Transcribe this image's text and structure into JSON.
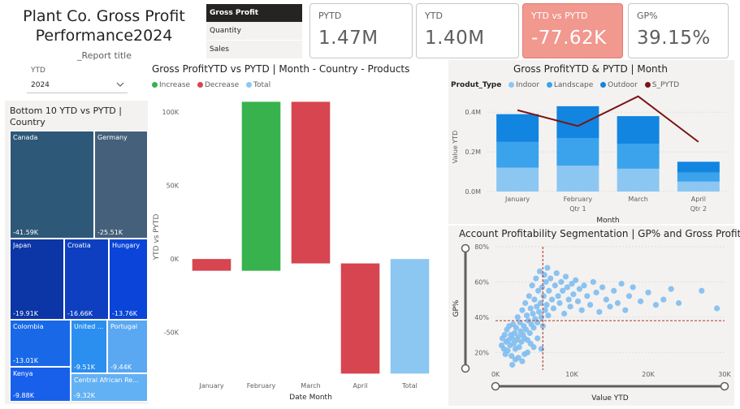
{
  "header": {
    "title_line1": "Plant Co. Gross Profit",
    "title_line2": "Performance2024",
    "report_title": "_Report title"
  },
  "slicer": {
    "label": "YTD",
    "value": "2024"
  },
  "segment_buttons": [
    {
      "label": "Gross Profit",
      "active": true
    },
    {
      "label": "Quantity",
      "active": false
    },
    {
      "label": "Sales",
      "active": false
    }
  ],
  "kpis": [
    {
      "label": "PYTD",
      "value": "1.47M"
    },
    {
      "label": "YTD",
      "value": "1.40M"
    },
    {
      "label": "YTD vs PYTD",
      "value": "-77.62K"
    },
    {
      "label": "GP%",
      "value": "39.15%"
    }
  ],
  "treemap": {
    "title": "Bottom 10 YTD vs PYTD | Country",
    "items": [
      {
        "name": "Canada",
        "value": "-41.59K",
        "color": "#2e5878"
      },
      {
        "name": "Germany",
        "value": "-25.51K",
        "color": "#44607a"
      },
      {
        "name": "Japan",
        "value": "-19.91K",
        "color": "#0c35a6"
      },
      {
        "name": "Croatia",
        "value": "-16.66K",
        "color": "#0d3fc0"
      },
      {
        "name": "Hungary",
        "value": "-13.76K",
        "color": "#0a44d8"
      },
      {
        "name": "Colombia",
        "value": "-13.01K",
        "color": "#1868e8"
      },
      {
        "name": "United ...",
        "value": "-9.51K",
        "color": "#2b8ff0"
      },
      {
        "name": "Portugal",
        "value": "-9.44K",
        "color": "#5aa8f2"
      },
      {
        "name": "Kenya",
        "value": "-9.88K",
        "color": "#1860ea"
      },
      {
        "name": "Central African Re...",
        "value": "-9.32K",
        "color": "#62b1f4"
      }
    ]
  },
  "waterfall": {
    "title": "Gross ProfitYTD vs PYTD | Month - Country - Products",
    "legend": [
      {
        "label": "Increase",
        "color": "#37b24d"
      },
      {
        "label": "Decrease",
        "color": "#d64550"
      },
      {
        "label": "Total",
        "color": "#8cc7f2"
      }
    ],
    "ylabel": "YTD vs PYTD",
    "xlabel": "Date Month"
  },
  "stacked": {
    "title": "Gross ProfitYTD & PYTD | Month",
    "legend_title": "Produt_Type",
    "legend": [
      {
        "label": "Indoor",
        "color": "#8cc7f2"
      },
      {
        "label": "Landscape",
        "color": "#3aa3ec"
      },
      {
        "label": "Outdoor",
        "color": "#1185e0"
      },
      {
        "label": "S_PYTD",
        "color": "#7b1414"
      }
    ],
    "ylabel": "Value YTD",
    "xlabel": "Month"
  },
  "scatter": {
    "title": "Account Profitability Segmentation | GP% and Gross Profit",
    "ylabel": "GP%",
    "xlabel": "Value YTD"
  },
  "chart_data": [
    {
      "type": "bar",
      "subtype": "waterfall",
      "categories": [
        "January",
        "February",
        "March",
        "April",
        "Total"
      ],
      "values": [
        -8000,
        115000,
        -110000,
        -75000,
        -78000
      ],
      "ylim": [
        -80000,
        110000
      ],
      "yticks": [
        "100K",
        "50K",
        "0K",
        "-50K"
      ],
      "ylabel": "YTD vs PYTD",
      "xlabel": "Date Month",
      "grid": false
    },
    {
      "type": "bar",
      "subtype": "stacked+line",
      "categories": [
        "January",
        "February",
        "March",
        "April"
      ],
      "category_groups": [
        "Qtr 1",
        "Qtr 1",
        "Qtr 1",
        "Qtr 2"
      ],
      "series": [
        {
          "name": "Indoor",
          "values": [
            120000,
            130000,
            115000,
            50000
          ]
        },
        {
          "name": "Landscape",
          "values": [
            130000,
            140000,
            125000,
            45000
          ]
        },
        {
          "name": "Outdoor",
          "values": [
            140000,
            160000,
            140000,
            55000
          ]
        }
      ],
      "line": {
        "name": "S_PYTD",
        "values": [
          410000,
          330000,
          480000,
          250000
        ]
      },
      "ylim": [
        0,
        450000
      ],
      "yticks": [
        "0.0M",
        "0.2M",
        "0.4M"
      ],
      "ylabel": "Value YTD",
      "xlabel": "Month"
    },
    {
      "type": "scatter",
      "xlim": [
        0,
        30000
      ],
      "ylim": [
        10,
        80
      ],
      "xticks": [
        "0K",
        "10K",
        "20K",
        "30K"
      ],
      "yticks": [
        "20%",
        "40%",
        "60%",
        "80%"
      ],
      "reference_lines": {
        "x": 6200,
        "y": 38
      },
      "xlabel": "Value YTD",
      "ylabel": "GP%",
      "points": [
        [
          800,
          24
        ],
        [
          900,
          28
        ],
        [
          1100,
          22
        ],
        [
          1200,
          30
        ],
        [
          1300,
          19
        ],
        [
          1400,
          26
        ],
        [
          1500,
          33
        ],
        [
          1600,
          21
        ],
        [
          1700,
          27
        ],
        [
          1800,
          35
        ],
        [
          1900,
          24
        ],
        [
          2000,
          30
        ],
        [
          2100,
          18
        ],
        [
          2200,
          28
        ],
        [
          2300,
          36
        ],
        [
          2400,
          25
        ],
        [
          2500,
          31
        ],
        [
          2600,
          22
        ],
        [
          2700,
          34
        ],
        [
          2800,
          27
        ],
        [
          2900,
          40
        ],
        [
          3000,
          29
        ],
        [
          3100,
          23
        ],
        [
          3200,
          37
        ],
        [
          3300,
          32
        ],
        [
          3400,
          26
        ],
        [
          3500,
          44
        ],
        [
          3600,
          30
        ],
        [
          3700,
          35
        ],
        [
          3800,
          28
        ],
        [
          3900,
          48
        ],
        [
          4000,
          33
        ],
        [
          4100,
          41
        ],
        [
          4200,
          27
        ],
        [
          4300,
          38
        ],
        [
          4400,
          52
        ],
        [
          4500,
          31
        ],
        [
          4600,
          45
        ],
        [
          4700,
          36
        ],
        [
          4800,
          58
        ],
        [
          4900,
          42
        ],
        [
          5000,
          34
        ],
        [
          5100,
          50
        ],
        [
          5200,
          39
        ],
        [
          5300,
          62
        ],
        [
          5400,
          46
        ],
        [
          5500,
          37
        ],
        [
          5600,
          55
        ],
        [
          5700,
          43
        ],
        [
          5800,
          66
        ],
        [
          5900,
          48
        ],
        [
          6000,
          40
        ],
        [
          6100,
          57
        ],
        [
          6200,
          35
        ],
        [
          6300,
          52
        ],
        [
          6400,
          64
        ],
        [
          6500,
          44
        ],
        [
          6600,
          60
        ],
        [
          6700,
          47
        ],
        [
          6800,
          68
        ],
        [
          6900,
          41
        ],
        [
          7000,
          55
        ],
        [
          7200,
          62
        ],
        [
          7400,
          50
        ],
        [
          7600,
          45
        ],
        [
          7800,
          58
        ],
        [
          8000,
          65
        ],
        [
          8200,
          52
        ],
        [
          8400,
          48
        ],
        [
          8600,
          60
        ],
        [
          8800,
          55
        ],
        [
          9000,
          42
        ],
        [
          9200,
          63
        ],
        [
          9400,
          57
        ],
        [
          9600,
          50
        ],
        [
          9800,
          46
        ],
        [
          10000,
          59
        ],
        [
          10200,
          53
        ],
        [
          10500,
          61
        ],
        [
          10800,
          49
        ],
        [
          11000,
          56
        ],
        [
          11300,
          44
        ],
        [
          11600,
          58
        ],
        [
          12000,
          52
        ],
        [
          12400,
          47
        ],
        [
          12800,
          60
        ],
        [
          13200,
          54
        ],
        [
          13600,
          43
        ],
        [
          14000,
          57
        ],
        [
          14500,
          50
        ],
        [
          15000,
          46
        ],
        [
          15500,
          55
        ],
        [
          16000,
          48
        ],
        [
          16500,
          59
        ],
        [
          17000,
          44
        ],
        [
          17500,
          52
        ],
        [
          18000,
          57
        ],
        [
          19000,
          49
        ],
        [
          20000,
          54
        ],
        [
          21000,
          47
        ],
        [
          22000,
          50
        ],
        [
          23000,
          56
        ],
        [
          24000,
          48
        ],
        [
          27000,
          55
        ],
        [
          29000,
          45
        ],
        [
          3000,
          17
        ],
        [
          3500,
          15
        ],
        [
          4200,
          20
        ],
        [
          2600,
          16
        ],
        [
          5000,
          23
        ],
        [
          3800,
          19
        ],
        [
          4600,
          25
        ],
        [
          2200,
          13
        ],
        [
          5500,
          28
        ],
        [
          6000,
          22
        ]
      ]
    }
  ]
}
